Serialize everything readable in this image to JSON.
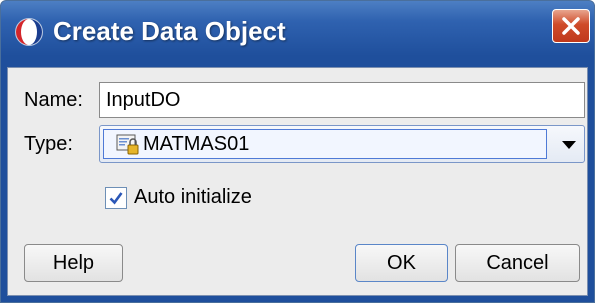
{
  "window": {
    "title": "Create Data Object",
    "icon": "oracle-logo-icon",
    "close_icon": "close-icon"
  },
  "form": {
    "name_label": "Name:",
    "name_value": "InputDO",
    "type_label": "Type:",
    "type_value": "MATMAS01",
    "type_icon": "data-object-lock-icon",
    "auto_initialize_label": "Auto initialize",
    "auto_initialize_checked": true
  },
  "buttons": {
    "help": "Help",
    "ok": "OK",
    "cancel": "Cancel"
  },
  "colors": {
    "titlebar": "#2f62b0",
    "close_button": "#c0391c",
    "client_bg": "#ececec"
  }
}
